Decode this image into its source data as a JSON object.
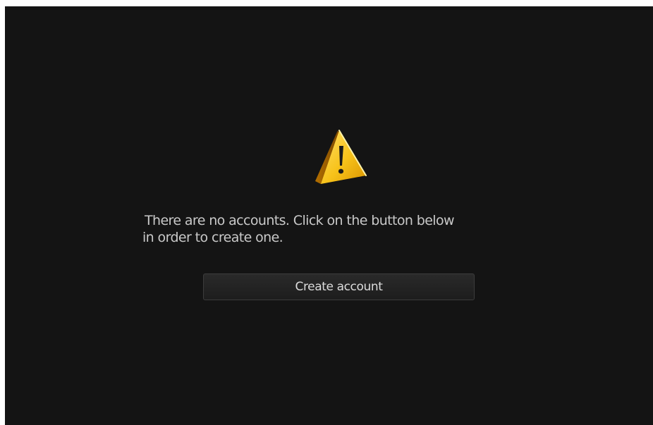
{
  "empty_state": {
    "icon": "warning-icon",
    "message_line1": "There are no accounts. Click on the button below",
    "message_line2": "in order to create one.",
    "button_label": "Create account"
  },
  "colors": {
    "background": "#141414",
    "text": "#c9c9c9",
    "button_bg": "#232323",
    "button_border": "#3c3c3c",
    "warning_yellow": "#f2b705"
  }
}
